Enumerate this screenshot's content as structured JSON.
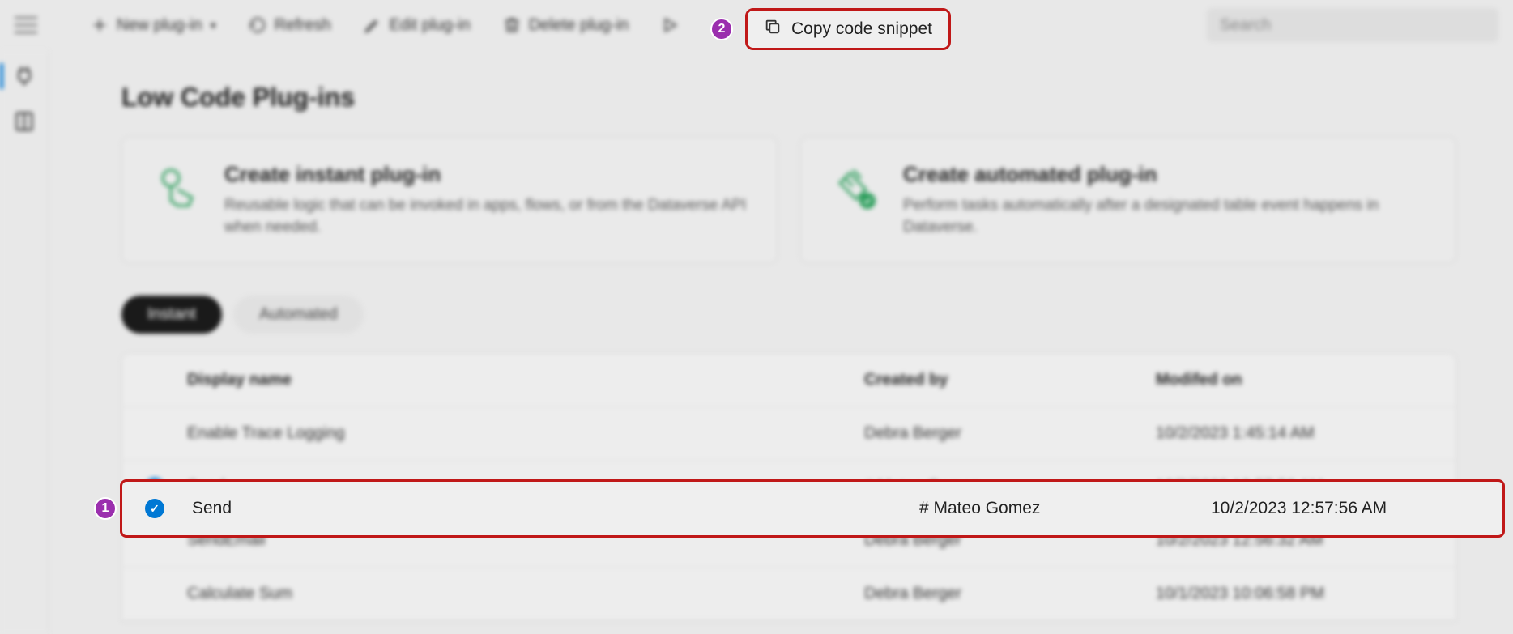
{
  "toolbar": {
    "new_plugin": "New plug-in",
    "refresh": "Refresh",
    "edit": "Edit plug-in",
    "delete": "Delete plug-in",
    "copy_snippet": "Copy code snippet",
    "search_placeholder": "Search"
  },
  "page": {
    "title": "Low Code Plug-ins"
  },
  "cards": {
    "instant": {
      "title": "Create instant plug-in",
      "desc": "Reusable logic that can be invoked in apps, flows, or from the Dataverse API when needed."
    },
    "automated": {
      "title": "Create automated plug-in",
      "desc": "Perform tasks automatically after a designated table event happens in Dataverse."
    }
  },
  "tabs": {
    "instant": "Instant",
    "automated": "Automated"
  },
  "table": {
    "headers": {
      "name": "Display name",
      "created_by": "Created by",
      "modified_on": "Modifed on"
    },
    "rows": [
      {
        "name": "Enable Trace Logging",
        "created_by": "Debra Berger",
        "modified_on": "10/2/2023 1:45:14 AM",
        "selected": false
      },
      {
        "name": "Send",
        "created_by": "# Mateo Gomez",
        "modified_on": "10/2/2023 12:57:56 AM",
        "selected": true
      },
      {
        "name": "SendEmail",
        "created_by": "Debra Berger",
        "modified_on": "10/2/2023 12:56:32 AM",
        "selected": false
      },
      {
        "name": "Calculate Sum",
        "created_by": "Debra Berger",
        "modified_on": "10/1/2023 10:06:58 PM",
        "selected": false
      }
    ]
  },
  "annotations": {
    "badge1": "1",
    "badge2": "2",
    "highlight_row": {
      "name": "Send",
      "created_by": "# Mateo Gomez",
      "modified_on": "10/2/2023 12:57:56 AM"
    }
  }
}
